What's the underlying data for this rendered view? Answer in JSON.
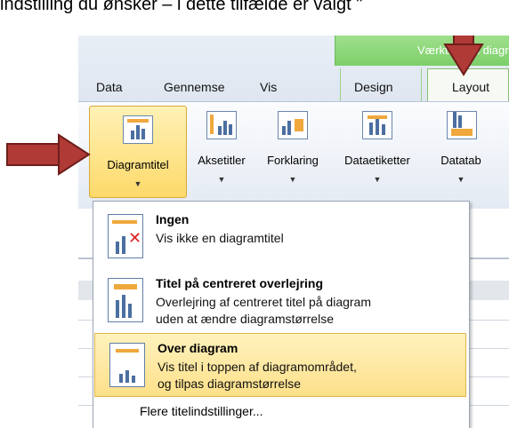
{
  "caption": "indstilling du ønsker – i dette tilfælde er valgt \"",
  "context_tab": "Værktøjer til diagrammer",
  "tabs": [
    {
      "label": "Data"
    },
    {
      "label": "Gennemse"
    },
    {
      "label": "Vis"
    },
    {
      "label": "Design"
    },
    {
      "label": "Layout"
    }
  ],
  "ribbon": {
    "buttons": [
      {
        "label": "Diagramtitel"
      },
      {
        "label": "Aksetitler"
      },
      {
        "label": "Forklaring"
      },
      {
        "label": "Dataetiketter"
      },
      {
        "label": "Datatab"
      }
    ]
  },
  "menu": {
    "items": [
      {
        "title": "Ingen",
        "desc1": "Vis ikke en diagramtitel",
        "desc2": ""
      },
      {
        "title": "Titel på centreret overlejring",
        "desc1": "Overlejring af centreret titel på diagram",
        "desc2": "uden at ændre diagramstørrelse"
      },
      {
        "title": "Over diagram",
        "desc1": "Vis titel i toppen af diagramområdet,",
        "desc2": "og tilpas diagramstørrelse"
      }
    ],
    "more_options": "Flere titelindstillinger..."
  },
  "colors": {
    "arrow": "#b03a36",
    "highlight": "#fde08a",
    "context_green": "#7ccf6a"
  }
}
